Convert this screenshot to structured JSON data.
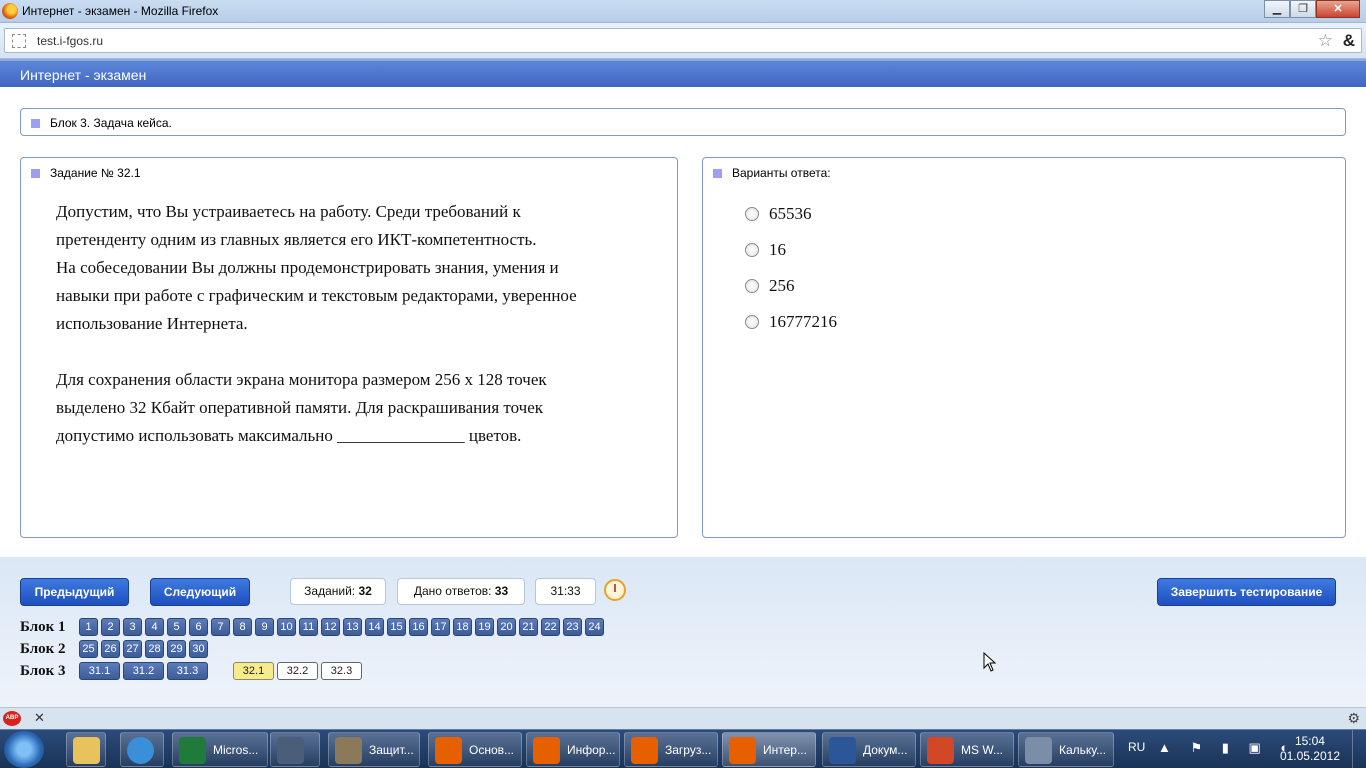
{
  "window": {
    "title": "Интернет - экзамен - Mozilla Firefox",
    "url": "test.i-fgos.ru",
    "min": "▁",
    "max": "❐",
    "close": "✕"
  },
  "app": {
    "header": "Интернет - экзамен"
  },
  "block": {
    "title": "Блок 3. Задача кейса."
  },
  "task": {
    "title": "Задание № 32.1",
    "para1": [
      "Допустим, что Вы устраиваетесь на работу. Среди требований к",
      "претенденту одним из главных является его ИКТ-компетентность.",
      "На собеседовании Вы должны продемонстрировать знания, умения и",
      "навыки при работе с графическим и текстовым редакторами, уверенное",
      "использование Интернета."
    ],
    "para2": [
      "Для сохранения области экрана монитора размером 256 х 128 точек",
      "выделено 32 Кбайт оперативной памяти. Для раскрашивания точек",
      "допустимо использовать максимально _______________ цветов."
    ]
  },
  "answers": {
    "title": "Варианты ответа:",
    "options": [
      "65536",
      "16",
      "256",
      "16777216"
    ]
  },
  "controls": {
    "prev": "Предыдущий",
    "next": "Следующий",
    "tasks_label": "Заданий:",
    "tasks_value": "32",
    "answered_label": "Дано ответов:",
    "answered_value": "33",
    "timer": "31:33",
    "finish": "Завершить тестирование"
  },
  "navigator": {
    "block1": {
      "label": "Блок 1",
      "items": [
        "1",
        "2",
        "3",
        "4",
        "5",
        "6",
        "7",
        "8",
        "9",
        "10",
        "11",
        "12",
        "13",
        "14",
        "15",
        "16",
        "17",
        "18",
        "19",
        "20",
        "21",
        "22",
        "23",
        "24"
      ]
    },
    "block2": {
      "label": "Блок 2",
      "items": [
        "25",
        "26",
        "27",
        "28",
        "29",
        "30"
      ]
    },
    "block3": {
      "label": "Блок 3",
      "items_done": [
        "31.1",
        "31.2",
        "31.3"
      ],
      "current": "32.1",
      "items_open": [
        "32.2",
        "32.3"
      ]
    }
  },
  "addonbar": {
    "abp": "ABP",
    "close": "✕",
    "gear": "⚙"
  },
  "taskbar": {
    "items": [
      {
        "label": "Micros...",
        "color": "#1e7b3a"
      },
      {
        "label": "",
        "color": "#4a5e7a"
      },
      {
        "label": "Защит...",
        "color": "#8a7a5a"
      },
      {
        "label": "Основ...",
        "color": "#e66000"
      },
      {
        "label": "Инфор...",
        "color": "#e66000"
      },
      {
        "label": "Загруз...",
        "color": "#e66000"
      },
      {
        "label": "Интер...",
        "color": "#e66000"
      },
      {
        "label": "Докум...",
        "color": "#2b579a"
      },
      {
        "label": "MS W...",
        "color": "#d24726"
      },
      {
        "label": "Кальку...",
        "color": "#7a8ea8"
      }
    ],
    "lang": "RU",
    "tray_icons": "▲ ⚑ ▮ ▣ ◐",
    "time": "15:04",
    "date": "01.05.2012"
  }
}
